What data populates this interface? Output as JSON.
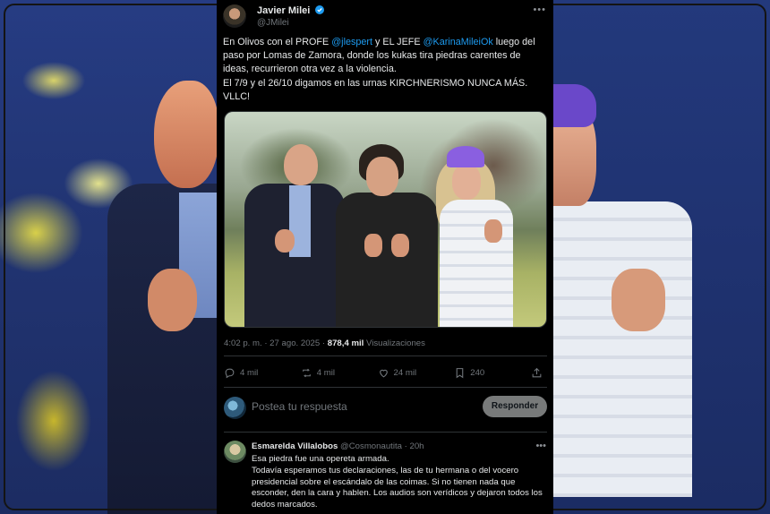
{
  "tweet": {
    "author_name": "Javier Milei",
    "author_handle": "@JMilei",
    "text_lines": [
      {
        "pre": "En Olivos con el PROFE ",
        "mention1": "@jlespert",
        "mid": " y EL JEFE ",
        "mention2": "@KarinaMileiOk",
        "post": " luego del"
      },
      "paso por Lomas de Zamora, donde los kukas tira piedras carentes de",
      "ideas, recurrieron otra vez a la violencia.",
      "El 7/9 y el 26/10 digamos en las urnas KIRCHNERISMO NUNCA MÁS.",
      "VLLC!"
    ],
    "timestamp": "4:02 p. m. · 27 ago. 2025",
    "views_count": "878,4 mil",
    "views_label": "Visualizaciones",
    "actions": {
      "replies": "4 mil",
      "reposts": "4 mil",
      "likes": "24 mil",
      "bookmarks": "240"
    }
  },
  "reply_box": {
    "placeholder": "Postea tu respuesta",
    "button_label": "Responder"
  },
  "comment": {
    "name": "Esmarelda Villalobos",
    "handle": "@Cosmonautita",
    "time": "· 20h",
    "lines": [
      "Esa piedra fue una opereta armada.",
      "Todavía esperamos tus declaraciones, las de tu hermana o del vocero",
      "presidencial sobre el escándalo de las coimas. Si no tienen nada que",
      "esconder, den la cara y hablen. Los audios son verídicos y dejaron todos los",
      "dedos marcados."
    ]
  },
  "icons": {
    "verified": "verified-badge-icon",
    "more": "more-icon",
    "reply": "reply-icon",
    "repost": "repost-icon",
    "like": "heart-icon",
    "bookmark": "bookmark-icon",
    "share": "share-icon"
  },
  "colors": {
    "accent": "#1d9bf0",
    "background": "#000000",
    "muted_text": "#71767b",
    "divider": "#2f3336"
  }
}
